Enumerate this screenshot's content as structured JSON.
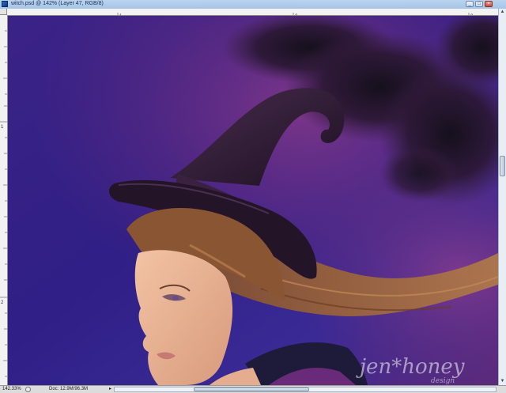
{
  "window": {
    "title": "witch.psd @ 142% (Layer 47, RGB/8)",
    "buttons": {
      "minimize": "_",
      "maximize": "□",
      "close": "×"
    }
  },
  "rulers": {
    "top_labels": [
      "1",
      "2",
      "3"
    ],
    "left_labels": [
      "1",
      "2"
    ]
  },
  "status": {
    "zoom": "142.33%",
    "doc": "Doc: 12.9M/96.3M",
    "arrow": "▸"
  },
  "watermark": {
    "line1": "jen*honey",
    "line2": "design"
  },
  "colors": {
    "sky_dark": "#26207a",
    "sky_purple": "#6a2b7a",
    "hat": "#2a1830",
    "hair": "#8a5532",
    "skin": "#e9b598"
  }
}
